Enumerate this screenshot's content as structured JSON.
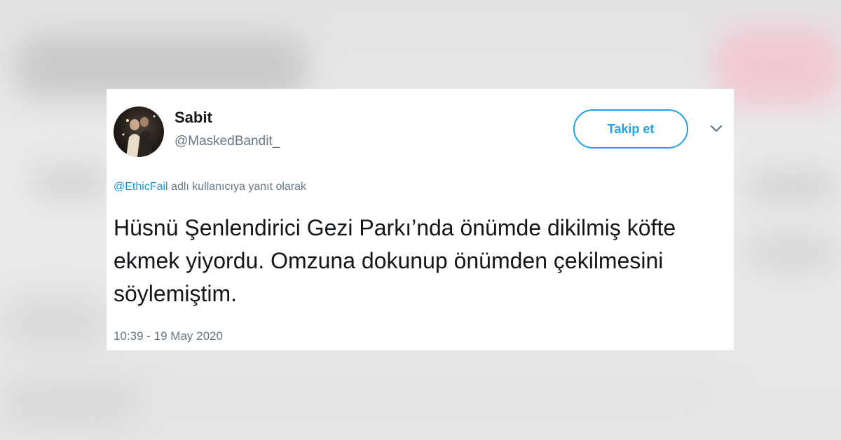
{
  "user": {
    "display_name": "Sabit",
    "handle": "@MaskedBandit_",
    "avatar_icon": "avatar-photo-icon"
  },
  "header": {
    "follow_label": "Takip et",
    "menu_icon": "chevron-down-icon"
  },
  "tweet": {
    "reply_mention": "@EthicFail",
    "reply_suffix": "adlı kullanıcıya yanıt olarak",
    "text": "Hüsnü Şenlendirici Gezi Parkı’nda önümde dikilmiş köfte ekmek yiyordu. Omzuna dokunup önümden çekilmesini söylemiştim.",
    "timestamp": "10:39 - 19 May 2020"
  },
  "colors": {
    "accent": "#1da1f2",
    "mention": "#1b95e0",
    "text_primary": "#14171a",
    "text_secondary": "#657786"
  }
}
